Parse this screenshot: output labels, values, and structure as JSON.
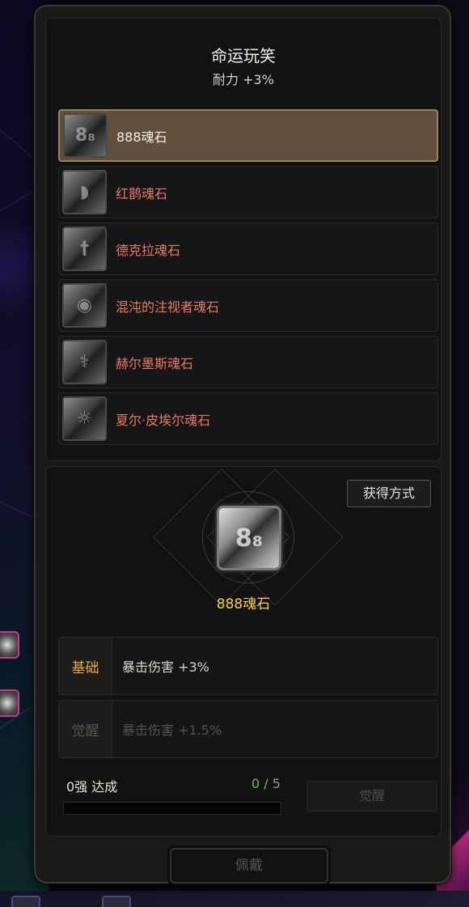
{
  "title": "命运玩笑",
  "subtitle": "耐力 +3%",
  "soulstones": [
    {
      "name": "888魂石",
      "icon": "888-stone-icon",
      "glyph": "8₈",
      "selected": true
    },
    {
      "name": "红鹊魂石",
      "icon": "magpie-stone-icon",
      "glyph": "◗",
      "selected": false
    },
    {
      "name": "德克拉魂石",
      "icon": "dekla-stone-icon",
      "glyph": "†",
      "selected": false
    },
    {
      "name": "混沌的注视者魂石",
      "icon": "eye-stone-icon",
      "glyph": "◉",
      "selected": false
    },
    {
      "name": "赫尔墨斯魂石",
      "icon": "hermes-stone-icon",
      "glyph": "⚕",
      "selected": false
    },
    {
      "name": "夏尔·皮埃尔魂石",
      "icon": "charles-stone-icon",
      "glyph": "☼",
      "selected": false
    }
  ],
  "acquire_label": "获得方式",
  "detail": {
    "name": "888魂石",
    "glyph": "8₈",
    "base_label": "基础",
    "base_value": "暴击伤害 +3%",
    "awaken_label": "觉醒",
    "awaken_value": "暴击伤害 +1.5%"
  },
  "progress": {
    "label": "0强 达成",
    "current": "0",
    "separator": " / ",
    "total": "5",
    "fraction": 0.0
  },
  "awaken_button": "觉醒",
  "equip_button": "佩戴",
  "colors": {
    "name_default": "#e67b62",
    "name_selected": "#f4efe6",
    "detail_name": "#f4d23c",
    "base_label": "#e9a93a",
    "progress_current": "#5ec24b"
  }
}
